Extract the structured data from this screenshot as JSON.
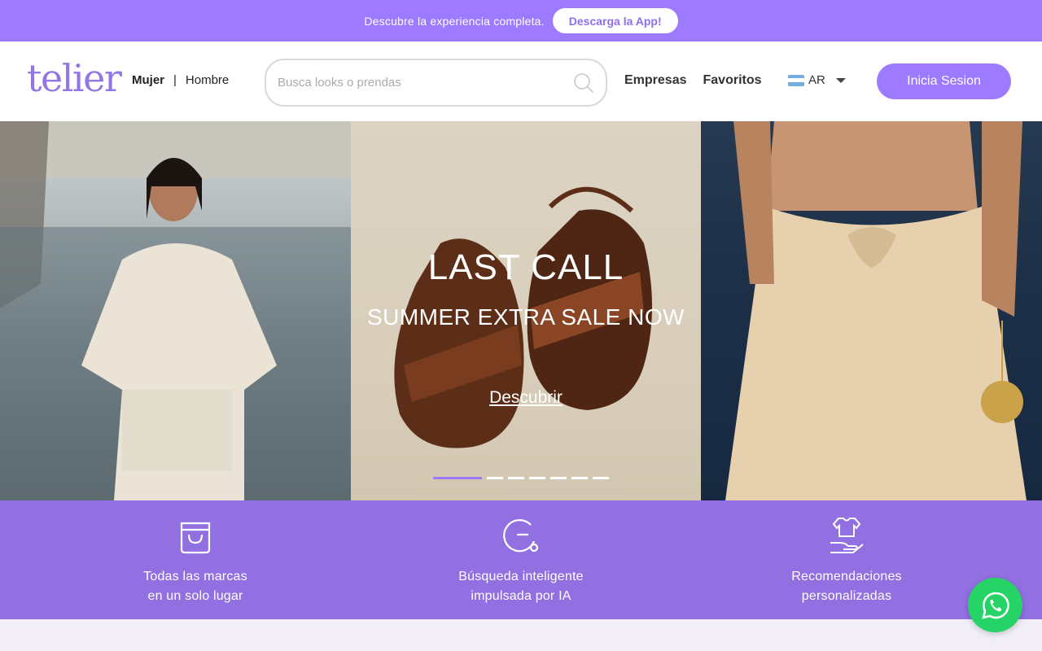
{
  "promo": {
    "text": "Descubre la experiencia completa.",
    "button_label": "Descarga la App!"
  },
  "header": {
    "logo": "telier",
    "gender": {
      "active": "Mujer",
      "separator": "|",
      "other": "Hombre"
    },
    "search": {
      "placeholder": "Busca looks o prendas",
      "icon": "search-icon"
    },
    "nav": {
      "empresas": "Empresas",
      "favoritos": "Favoritos"
    },
    "country": {
      "code": "AR",
      "flag_colors": [
        "#74acdf",
        "#ffffff",
        "#74acdf"
      ]
    },
    "login_label": "Inicia Sesion"
  },
  "hero": {
    "title": "LAST CALL",
    "subtitle": "SUMMER EXTRA SALE NOW",
    "cta": "Descubrir",
    "slides_count": 7,
    "active_slide": 1
  },
  "features": [
    {
      "icon": "shopping-bag-icon",
      "line1": "Todas las marcas",
      "line2": "en un solo lugar"
    },
    {
      "icon": "ai-search-icon",
      "line1": "Búsqueda inteligente",
      "line2": "impulsada por IA"
    },
    {
      "icon": "shirt-hand-icon",
      "line1": "Recomendaciones",
      "line2": "personalizadas"
    }
  ],
  "colors": {
    "brand": "#9d7aff",
    "features_bg": "#9270e2",
    "whatsapp": "#25d366"
  },
  "whatsapp": {
    "icon": "whatsapp-icon"
  }
}
